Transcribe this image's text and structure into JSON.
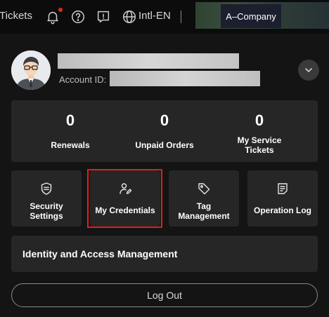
{
  "topbar": {
    "tickets_label": "Tickets",
    "language_label": "Intl-EN",
    "company_label": "A–Company",
    "icons": [
      "bell-icon",
      "help-icon",
      "feedback-icon",
      "globe-icon"
    ],
    "notification_dot_color": "#e0271f"
  },
  "account": {
    "id_label": "Account ID:",
    "avatar_icon": "user-avatar-icon",
    "expand_icon": "chevron-down-icon"
  },
  "stats": [
    {
      "value": "0",
      "label": "Renewals"
    },
    {
      "value": "0",
      "label": "Unpaid Orders"
    },
    {
      "value": "0",
      "label": "My Service\nTickets"
    }
  ],
  "tiles": [
    {
      "label": "Security\nSettings",
      "icon": "security-settings-icon"
    },
    {
      "label": "My Credentials",
      "icon": "credentials-icon"
    },
    {
      "label": "Tag\nManagement",
      "icon": "tag-icon"
    },
    {
      "label": "Operation Log",
      "icon": "operation-log-icon"
    }
  ],
  "iam": {
    "label": "Identity and Access Management"
  },
  "logout": {
    "label": "Log Out"
  },
  "colors": {
    "highlight": "#e41c1c",
    "background": "#141414",
    "card": "#262626"
  }
}
